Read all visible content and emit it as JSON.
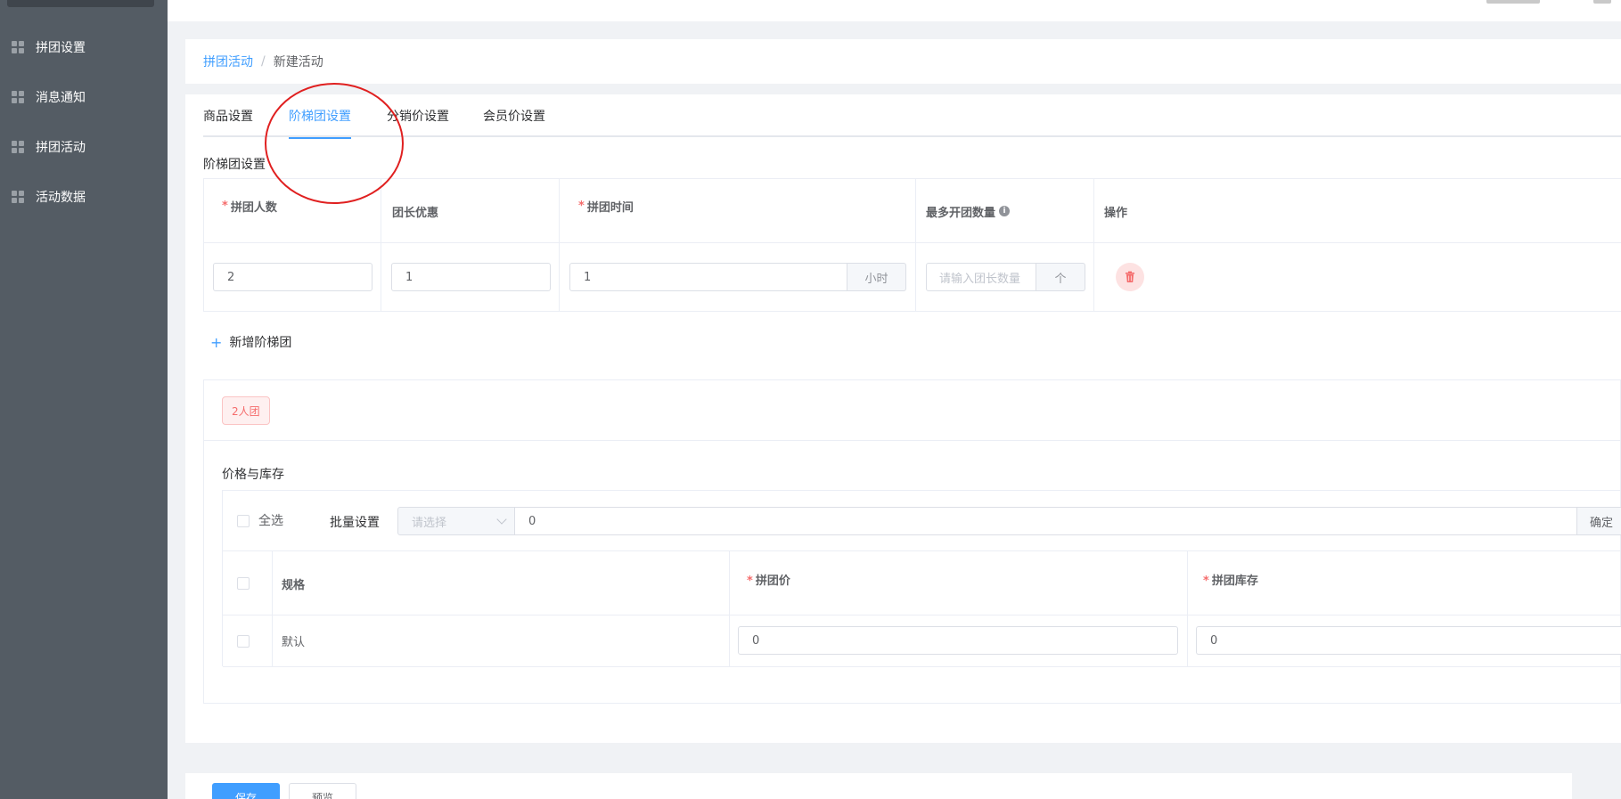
{
  "sidebar": {
    "items": [
      {
        "label": "拼团设置",
        "icon": "grid-icon"
      },
      {
        "label": "消息通知",
        "icon": "grid-icon"
      },
      {
        "label": "拼团活动",
        "icon": "grid-icon"
      },
      {
        "label": "活动数据",
        "icon": "grid-icon"
      }
    ]
  },
  "breadcrumb": {
    "parent": "拼团活动",
    "separator": "/",
    "current": "新建活动"
  },
  "tabs": [
    {
      "label": "商品设置"
    },
    {
      "label": "阶梯团设置",
      "active": true
    },
    {
      "label": "分销价设置"
    },
    {
      "label": "会员价设置"
    }
  ],
  "tier_section": {
    "title": "阶梯团设置",
    "columns": {
      "group_size": "拼团人数",
      "leader_discount": "团长优惠",
      "group_time": "拼团时间",
      "max_groups": "最多开团数量",
      "actions": "操作"
    },
    "row": {
      "group_size": "2",
      "leader_discount": "1",
      "group_time": "1",
      "group_time_unit": "小时",
      "max_groups_placeholder": "请输入团长数量",
      "max_groups_unit": "个"
    },
    "add_label": "新增阶梯团"
  },
  "group_card": {
    "tag": "2人团",
    "price_stock_title": "价格与库存",
    "select_all_label": "全选",
    "bulk_label": "批量设置",
    "bulk_select_placeholder": "请选择",
    "bulk_value": "0",
    "confirm_label": "确定",
    "columns": {
      "spec": "规格",
      "price": "拼团价",
      "stock": "拼团库存"
    },
    "rows": [
      {
        "spec": "默认",
        "price": "0",
        "stock": "0"
      }
    ]
  },
  "actions": {
    "save": "保存",
    "preview": "预览"
  },
  "colors": {
    "primary": "#409eff",
    "danger": "#f56c6c",
    "sidebar": "#545c64",
    "annotation": "#e02020"
  }
}
